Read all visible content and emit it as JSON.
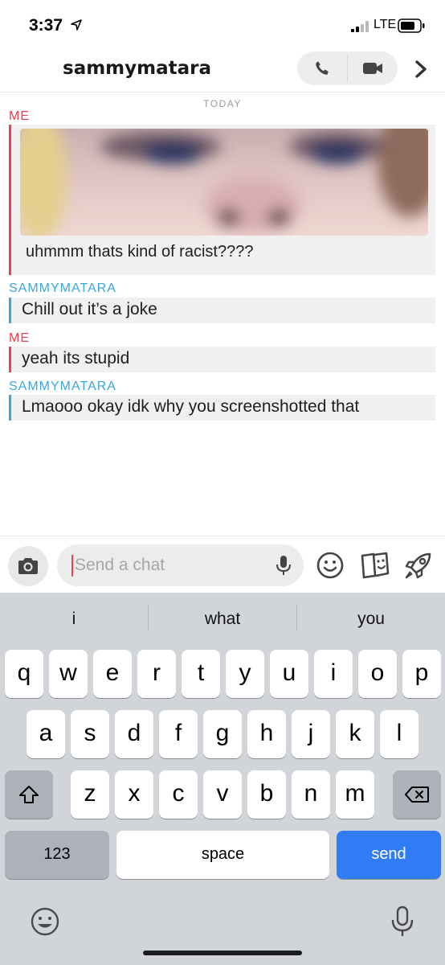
{
  "status_bar": {
    "time": "3:37",
    "network": "LTE"
  },
  "header": {
    "contact_name": "sammymatara"
  },
  "conversation": {
    "day_label": "TODAY",
    "messages": [
      {
        "sender": "ME",
        "caption": "uhmmm thats kind of racist????"
      },
      {
        "sender": "SAMMYMATARA",
        "text": "Chill out it’s a joke"
      },
      {
        "sender": "ME",
        "text": "yeah its stupid"
      },
      {
        "sender": "SAMMYMATARA",
        "text": "Lmaooo okay idk why you screenshotted that"
      }
    ]
  },
  "input_bar": {
    "placeholder": "Send a chat"
  },
  "keyboard": {
    "suggestions": [
      "i",
      "what",
      "you"
    ],
    "row1": [
      "q",
      "w",
      "e",
      "r",
      "t",
      "y",
      "u",
      "i",
      "o",
      "p"
    ],
    "row2": [
      "a",
      "s",
      "d",
      "f",
      "g",
      "h",
      "j",
      "k",
      "l"
    ],
    "row3": [
      "z",
      "x",
      "c",
      "v",
      "b",
      "n",
      "m"
    ],
    "numbers_label": "123",
    "space_label": "space",
    "send_label": "send"
  },
  "colors": {
    "me": "#e8434e",
    "them": "#3ea6dd",
    "send_key": "#2f7cf6"
  },
  "icons": [
    "location-arrow-icon",
    "signal-icon",
    "battery-icon",
    "phone-icon",
    "video-camera-icon",
    "chevron-right-icon",
    "camera-icon",
    "microphone-icon",
    "smiley-icon",
    "stickers-icon",
    "rocket-icon",
    "shift-icon",
    "backspace-icon",
    "emoji-icon",
    "dictation-icon"
  ]
}
